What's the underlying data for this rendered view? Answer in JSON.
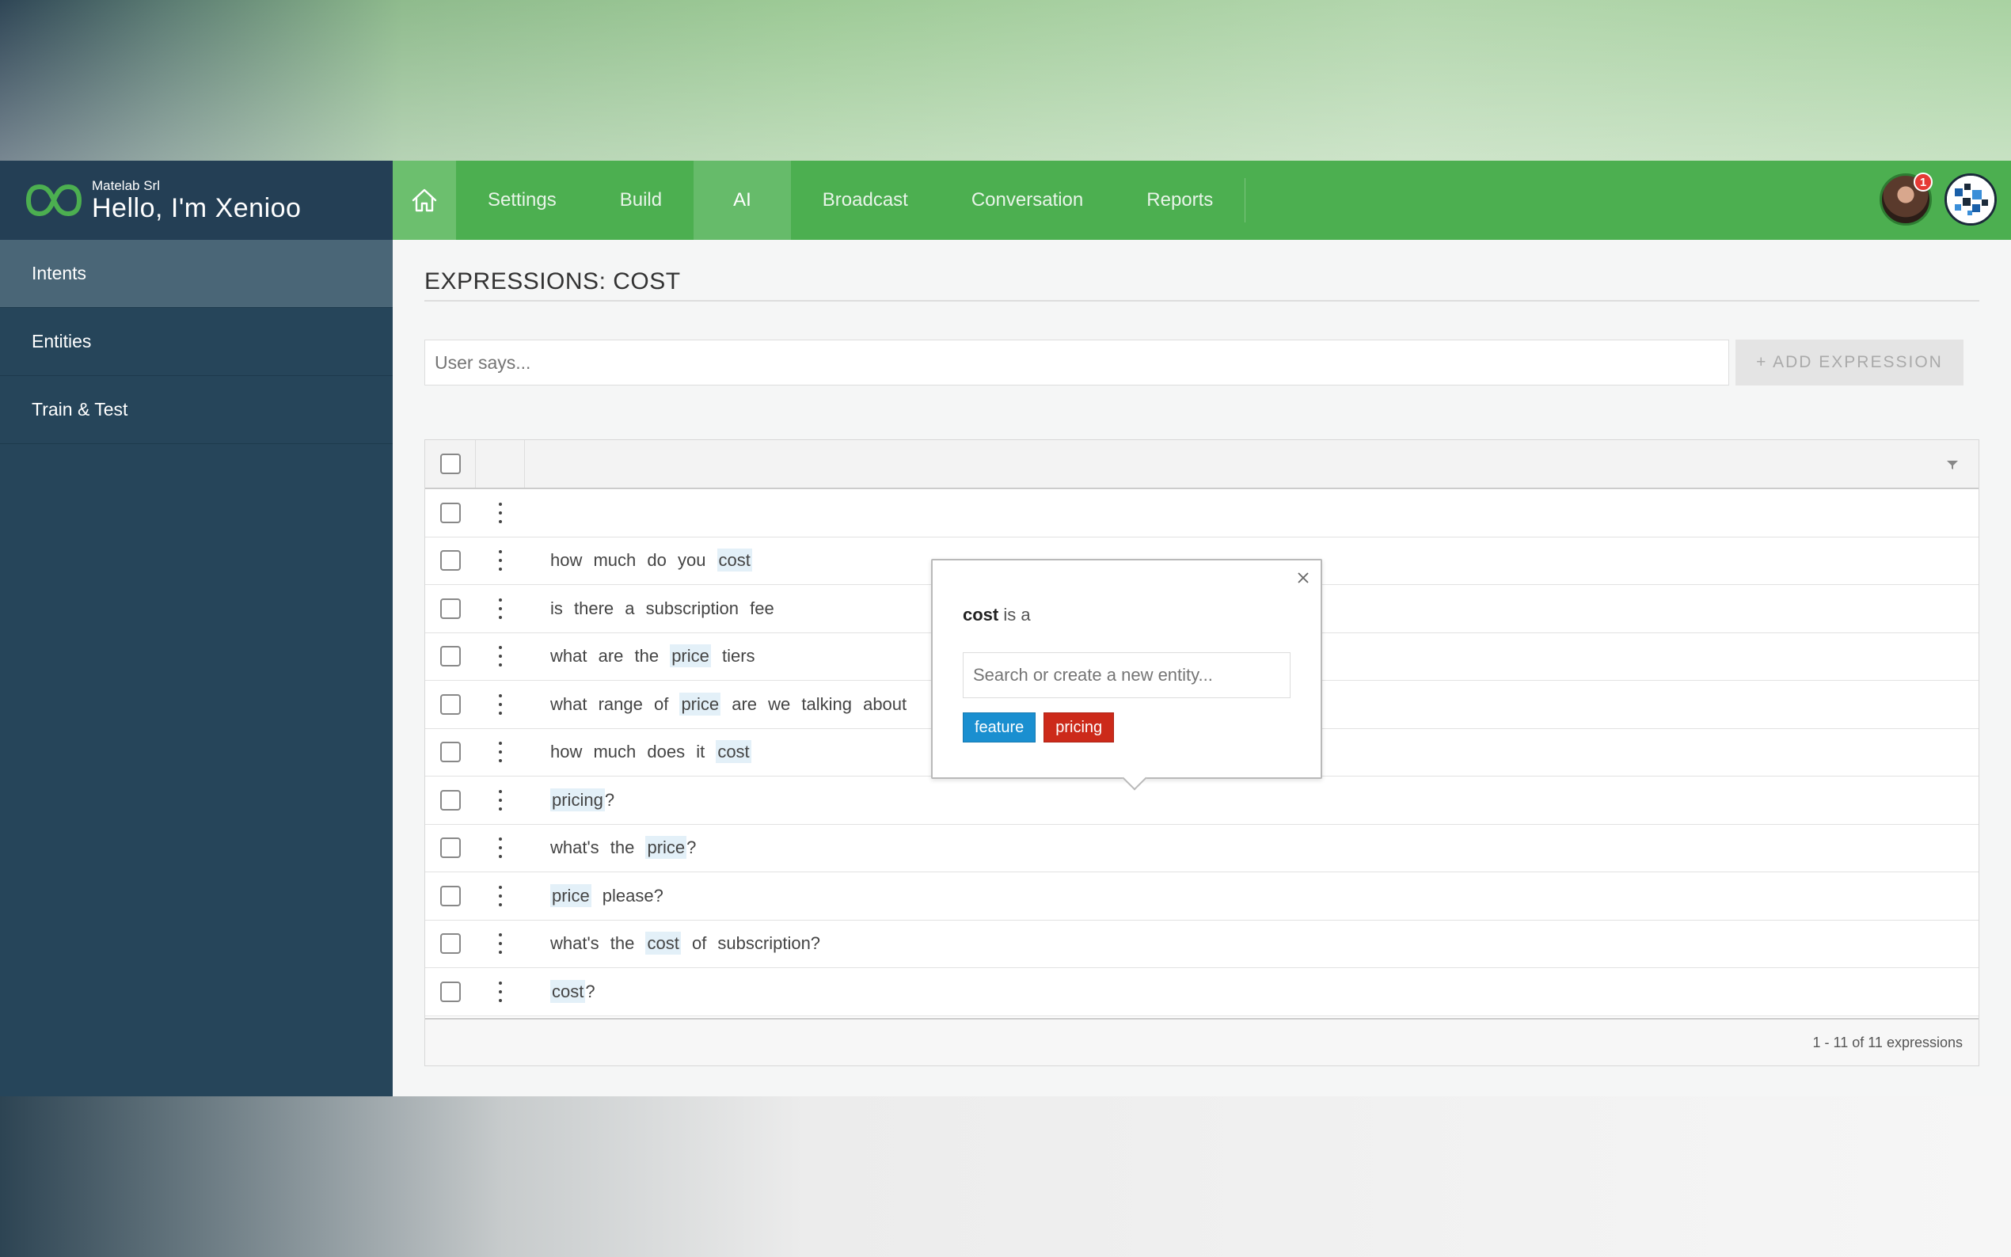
{
  "brand": {
    "company": "Matelab Srl",
    "title": "Hello, I'm Xenioo",
    "accent": "#4caf50"
  },
  "nav": {
    "home_icon": "home-icon",
    "items": [
      {
        "label": "Settings",
        "active": false
      },
      {
        "label": "Build",
        "active": false
      },
      {
        "label": "AI",
        "active": true
      },
      {
        "label": "Broadcast",
        "active": false
      },
      {
        "label": "Conversation",
        "active": false
      },
      {
        "label": "Reports",
        "active": false
      }
    ],
    "notification_count": "1"
  },
  "sidebar": {
    "items": [
      {
        "label": "Intents",
        "active": true
      },
      {
        "label": "Entities",
        "active": false
      },
      {
        "label": "Train & Test",
        "active": false
      }
    ]
  },
  "main": {
    "title": "EXPRESSIONS: COST",
    "input_placeholder": "User says...",
    "add_button": "+ ADD EXPRESSION"
  },
  "table": {
    "rows": [
      [
        {
          "t": ""
        }
      ],
      [
        {
          "t": "how much do you "
        },
        {
          "t": "cost",
          "ent": true
        }
      ],
      [
        {
          "t": "is there a subscription fee"
        }
      ],
      [
        {
          "t": "what are the "
        },
        {
          "t": "price",
          "ent": true
        },
        {
          "t": " tiers"
        }
      ],
      [
        {
          "t": "what range of "
        },
        {
          "t": "price",
          "ent": true
        },
        {
          "t": " are we talking about"
        }
      ],
      [
        {
          "t": "how much does it "
        },
        {
          "t": "cost",
          "ent": true
        }
      ],
      [
        {
          "t": "pricing",
          "ent": true
        },
        {
          "t": "?"
        }
      ],
      [
        {
          "t": "what's the "
        },
        {
          "t": "price",
          "ent": true
        },
        {
          "t": "?"
        }
      ],
      [
        {
          "t": "price",
          "ent": true
        },
        {
          "t": " please?"
        }
      ],
      [
        {
          "t": "what's the "
        },
        {
          "t": "cost",
          "ent": true
        },
        {
          "t": " of subscription?"
        }
      ],
      [
        {
          "t": "cost",
          "ent": true
        },
        {
          "t": "?"
        }
      ]
    ],
    "footer": "1 - 11 of 11 expressions"
  },
  "popover": {
    "word": "cost",
    "suffix": " is a",
    "search_placeholder": "Search or create a new entity...",
    "tags": [
      {
        "label": "feature",
        "color": "#1a8fd0"
      },
      {
        "label": "pricing",
        "color": "#cc2a1a"
      }
    ]
  }
}
